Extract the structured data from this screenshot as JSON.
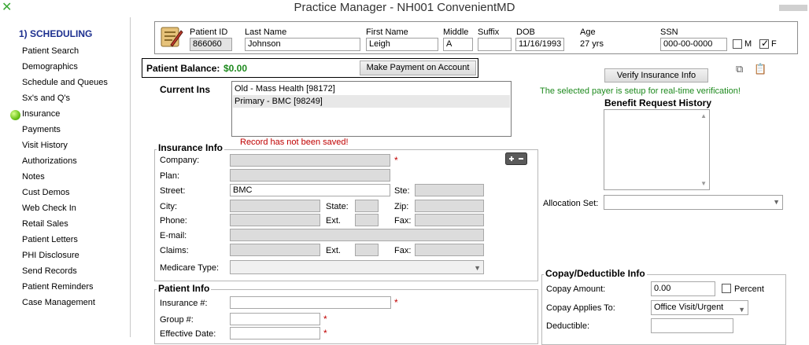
{
  "window": {
    "title": "Practice Manager - NH001 ConvenientMD",
    "app_icon": "excel-x-icon"
  },
  "sidebar": {
    "section": "1) SCHEDULING",
    "items": [
      "Patient Search",
      "Demographics",
      "Schedule and Queues",
      "Sx's and Q's",
      "Insurance",
      "Payments",
      "Visit History",
      "Authorizations",
      "Notes",
      "Cust Demos",
      "Web Check In",
      "Retail Sales",
      "Patient Letters",
      "PHI Disclosure",
      "Send Records",
      "Patient Reminders",
      "Case Management"
    ],
    "active_item": "Insurance"
  },
  "patient_header": {
    "labels": {
      "patient_id": "Patient ID",
      "last_name": "Last Name",
      "first_name": "First Name",
      "middle": "Middle",
      "suffix": "Suffix",
      "dob": "DOB",
      "age": "Age",
      "ssn": "SSN",
      "m": "M",
      "f": "F"
    },
    "values": {
      "patient_id": "866060",
      "last_name": "Johnson",
      "first_name": "Leigh",
      "middle": "A",
      "suffix": "",
      "dob": "11/16/1993",
      "age": "27 yrs",
      "ssn": "000-00-0000"
    },
    "sex_m_checked": false,
    "sex_f_checked": true
  },
  "balance": {
    "label": "Patient Balance:",
    "value": "$0.00",
    "payment_button": "Make Payment on Account"
  },
  "current_ins": {
    "label": "Current Ins",
    "items": [
      "Old - Mass Health  [98172]",
      "Primary - BMC  [98249]"
    ],
    "selected_index": 1
  },
  "status_message": "Record has not been saved!",
  "insurance_info": {
    "title": "Insurance Info",
    "labels": {
      "company": "Company:",
      "plan": "Plan:",
      "street": "Street:",
      "ste": "Ste:",
      "city": "City:",
      "state": "State:",
      "zip": "Zip:",
      "phone": "Phone:",
      "ext": "Ext.",
      "fax": "Fax:",
      "email": "E-mail:",
      "claims": "Claims:",
      "claims_ext": "Ext.",
      "claims_fax": "Fax:",
      "medicare_type": "Medicare Type:"
    },
    "values": {
      "street": "BMC"
    }
  },
  "patient_info": {
    "title": "Patient Info",
    "labels": {
      "insurance_no": "Insurance #:",
      "group_no": "Group #:",
      "effective_date": "Effective Date:"
    }
  },
  "right_panel": {
    "verify_button": "Verify Insurance Info",
    "verify_message": "The selected payer is setup for real-time verification!",
    "benefit_history_label": "Benefit Request History",
    "allocation_label": "Allocation Set:",
    "allocation_value": ""
  },
  "copay": {
    "title": "Copay/Deductible Info",
    "labels": {
      "copay_amount": "Copay Amount:",
      "percent": "Percent",
      "copay_applies": "Copay Applies To:",
      "deductible": "Deductible:"
    },
    "values": {
      "copay_amount": "0.00",
      "copay_applies": "Office Visit/Urgent",
      "deductible": ""
    }
  },
  "colors": {
    "accent_navy": "#1c2f8f",
    "success_green": "#1e8a1e",
    "error_red": "#c00000"
  }
}
